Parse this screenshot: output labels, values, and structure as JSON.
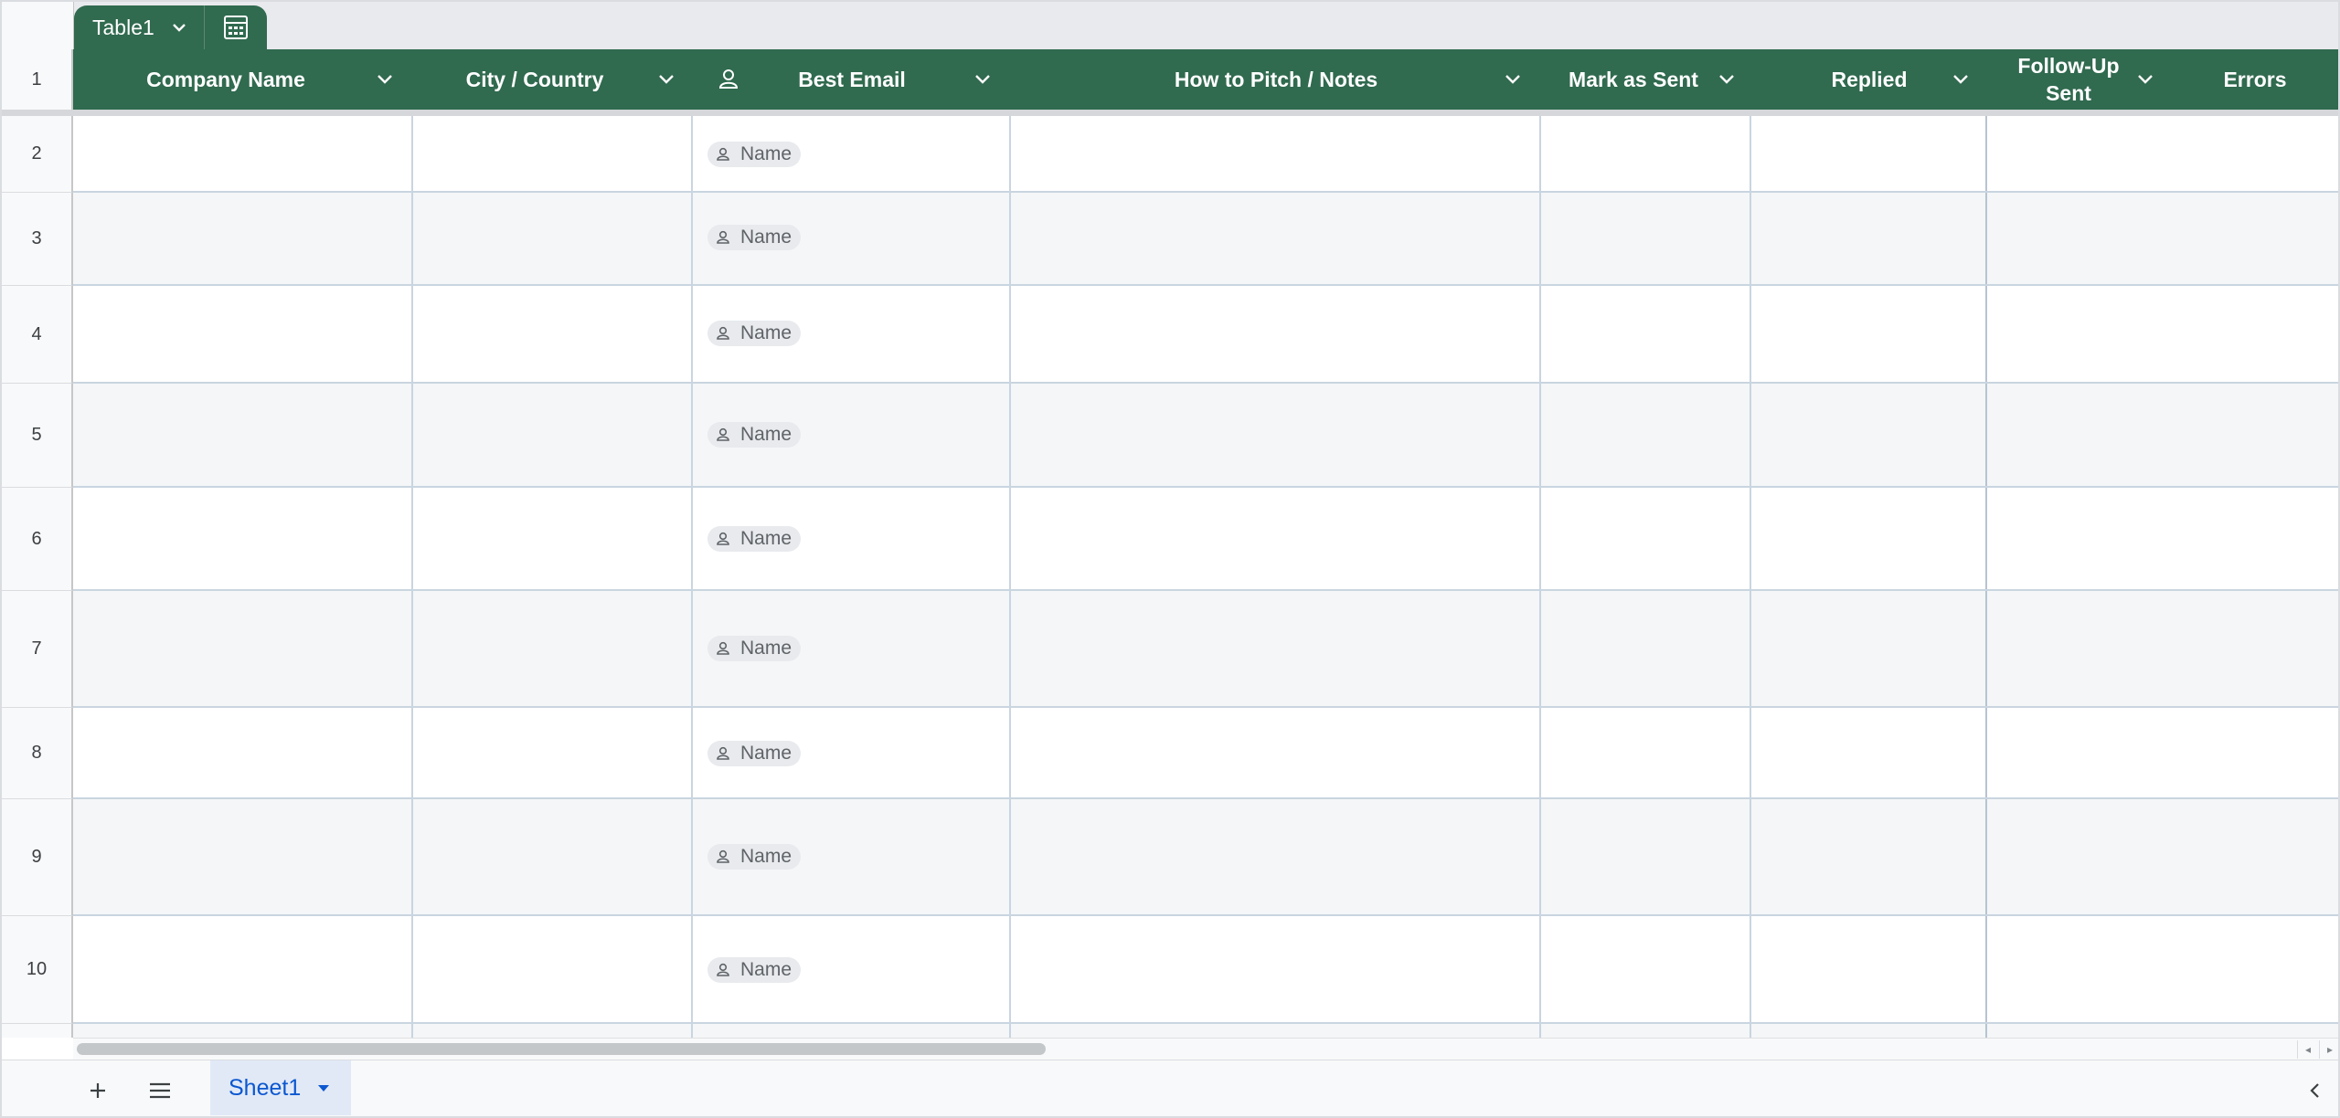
{
  "table": {
    "name": "Table1"
  },
  "header": {
    "row_number": "1",
    "columns": [
      {
        "label": "Company Name"
      },
      {
        "label": "City / Country"
      },
      {
        "label": "Best Email"
      },
      {
        "label": "How to Pitch / Notes"
      },
      {
        "label": "Mark as Sent"
      },
      {
        "label": "Replied"
      },
      {
        "label": "Follow-Up Sent"
      },
      {
        "label": "Errors"
      }
    ]
  },
  "rows": [
    {
      "num": "2",
      "chip": "Name"
    },
    {
      "num": "3",
      "chip": "Name"
    },
    {
      "num": "4",
      "chip": "Name"
    },
    {
      "num": "5",
      "chip": "Name"
    },
    {
      "num": "6",
      "chip": "Name"
    },
    {
      "num": "7",
      "chip": "Name"
    },
    {
      "num": "8",
      "chip": "Name"
    },
    {
      "num": "9",
      "chip": "Name"
    },
    {
      "num": "10",
      "chip": "Name"
    }
  ],
  "sheets": {
    "active": "Sheet1"
  },
  "colors": {
    "header_green": "#306a4f",
    "sheet_tab_bg": "#e1e9f7",
    "sheet_tab_text": "#0b57d0"
  }
}
